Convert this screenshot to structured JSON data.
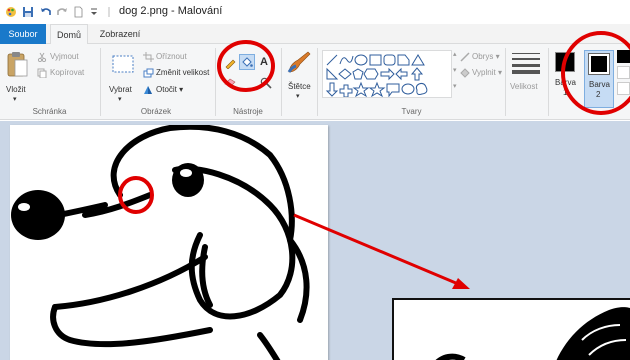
{
  "window": {
    "file_name": "dog 2.png",
    "app_name": "Malování",
    "separator": " - "
  },
  "tabs": [
    {
      "label": "Soubor"
    },
    {
      "label": "Domů"
    },
    {
      "label": "Zobrazení"
    }
  ],
  "ribbon": {
    "clipboard": {
      "paste": "Vložit",
      "cut": "Vyjmout",
      "copy": "Kopírovat",
      "group": "Schránka"
    },
    "image": {
      "select": "Vybrat",
      "crop": "Oříznout",
      "resize": "Změnit velikost",
      "rotate": "Otočit",
      "group": "Obrázek"
    },
    "tools": {
      "group": "Nástroje",
      "text_tool": "A"
    },
    "brushes": {
      "label": "Štětce"
    },
    "shapes": {
      "outline": "Obrys",
      "fill": "Vyplnit",
      "group": "Tvary"
    },
    "size": {
      "label": "Velikost"
    },
    "colors": {
      "color1": "Barva",
      "color1_num": "1",
      "color2": "Barva",
      "color2_num": "2"
    }
  },
  "colors": {
    "accent": "#1979ca",
    "annotation": "#e00000",
    "canvas_bg": "#cad6e6",
    "ribbon_bg": "#f5f6f7"
  }
}
